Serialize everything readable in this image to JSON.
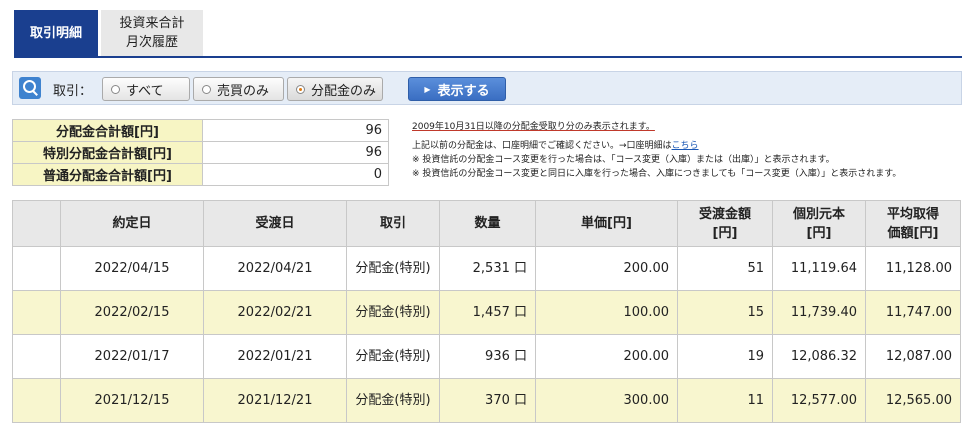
{
  "tabs": [
    {
      "label": "取引明細"
    },
    {
      "line1": "投資来合計",
      "line2": "月次履歴"
    }
  ],
  "filter": {
    "label": "取引：",
    "options": [
      "すべて",
      "売買のみ",
      "分配金のみ"
    ],
    "selected": "分配金のみ",
    "show_button": "表示する"
  },
  "summary": [
    {
      "label": "分配金合計額[円]",
      "value": "96"
    },
    {
      "label": "特別分配金合計額[円]",
      "value": "96"
    },
    {
      "label": "普通分配金合計額[円]",
      "value": "0"
    }
  ],
  "notes": {
    "main": "2009年10月31日以降の分配金受取り分のみ表示されます。",
    "line2_prefix": "上記以前の分配金は、口座明細でご確認ください。→口座明細は",
    "line2_link": "こちら",
    "note1": "※ 投資信託の分配金コース変更を行った場合は、「コース変更（入庫）または（出庫）」と表示されます。",
    "note2": "※ 投資信託の分配金コース変更と同日に入庫を行った場合、入庫につきましても「コース変更（入庫）」と表示されます。"
  },
  "table": {
    "headers": [
      "",
      "約定日",
      "受渡日",
      "取引",
      "数量",
      "単価[円]",
      "受渡金額[円]",
      "個別元本[円]",
      "平均取得価額[円]"
    ],
    "header_lines": {
      "amount": [
        "受渡金額",
        "[円]"
      ],
      "principal": [
        "個別元本",
        "[円]"
      ],
      "avg": [
        "平均取得",
        "価額[円]"
      ]
    },
    "rows": [
      {
        "trade_date": "2022/04/15",
        "settle_date": "2022/04/21",
        "type": "分配金(特別)",
        "qty": "2,531 口",
        "price": "200.00",
        "amount": "51",
        "principal": "11,119.64",
        "avg": "11,128.00"
      },
      {
        "trade_date": "2022/02/15",
        "settle_date": "2022/02/21",
        "type": "分配金(特別)",
        "qty": "1,457 口",
        "price": "100.00",
        "amount": "15",
        "principal": "11,739.40",
        "avg": "11,747.00"
      },
      {
        "trade_date": "2022/01/17",
        "settle_date": "2022/01/21",
        "type": "分配金(特別)",
        "qty": "936 口",
        "price": "200.00",
        "amount": "19",
        "principal": "12,086.32",
        "avg": "12,087.00"
      },
      {
        "trade_date": "2021/12/15",
        "settle_date": "2021/12/21",
        "type": "分配金(特別)",
        "qty": "370 口",
        "price": "300.00",
        "amount": "11",
        "principal": "12,577.00",
        "avg": "12,565.00"
      }
    ]
  },
  "colors": {
    "accent": "#1a3f8f",
    "summary_label_bg": "#f7f5c4",
    "row_alt_bg": "#f8f6cf",
    "button": "#3a6ec2"
  }
}
